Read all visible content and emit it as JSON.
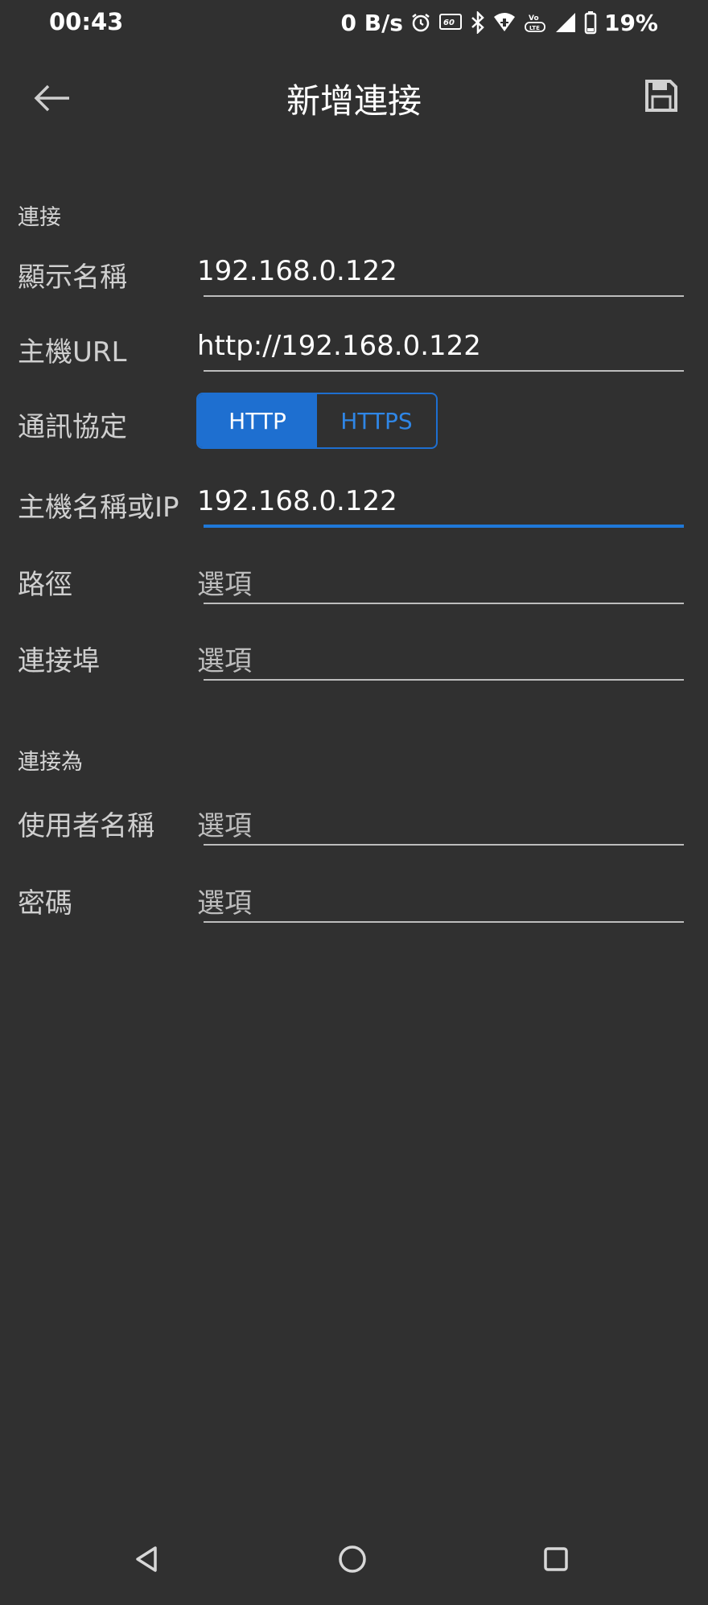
{
  "status_bar": {
    "time": "00:43",
    "net_speed": "0 B/s",
    "battery": "19%",
    "icons": [
      "alarm-icon",
      "refresh-rate-60hz-icon",
      "bluetooth-icon",
      "wifi-icon",
      "volte-icon",
      "cell-signal-icon",
      "battery-icon"
    ]
  },
  "app_bar": {
    "title": "新增連接",
    "back_icon": "arrow-left-icon",
    "save_icon": "floppy-disk-icon"
  },
  "sections": {
    "connection": "連接",
    "connect_as": "連接為"
  },
  "fields": {
    "display_name": {
      "label": "顯示名稱",
      "value": "192.168.0.122"
    },
    "host_url": {
      "label": "主機URL",
      "value": "http://192.168.0.122"
    },
    "protocol": {
      "label": "通訊協定",
      "options": [
        "HTTP",
        "HTTPS"
      ],
      "selected": "HTTP"
    },
    "host": {
      "label": "主機名稱或IP",
      "value": "192.168.0.122"
    },
    "path": {
      "label": "路徑",
      "placeholder": "選項"
    },
    "port": {
      "label": "連接埠",
      "placeholder": "選項"
    },
    "username": {
      "label": "使用者名稱",
      "placeholder": "選項"
    },
    "password": {
      "label": "密碼",
      "placeholder": "選項"
    }
  },
  "colors": {
    "background": "#303030",
    "accent": "#1e6fd0"
  },
  "nav_bar": {
    "icons": [
      "back-triangle-icon",
      "home-circle-icon",
      "recents-square-icon"
    ]
  }
}
